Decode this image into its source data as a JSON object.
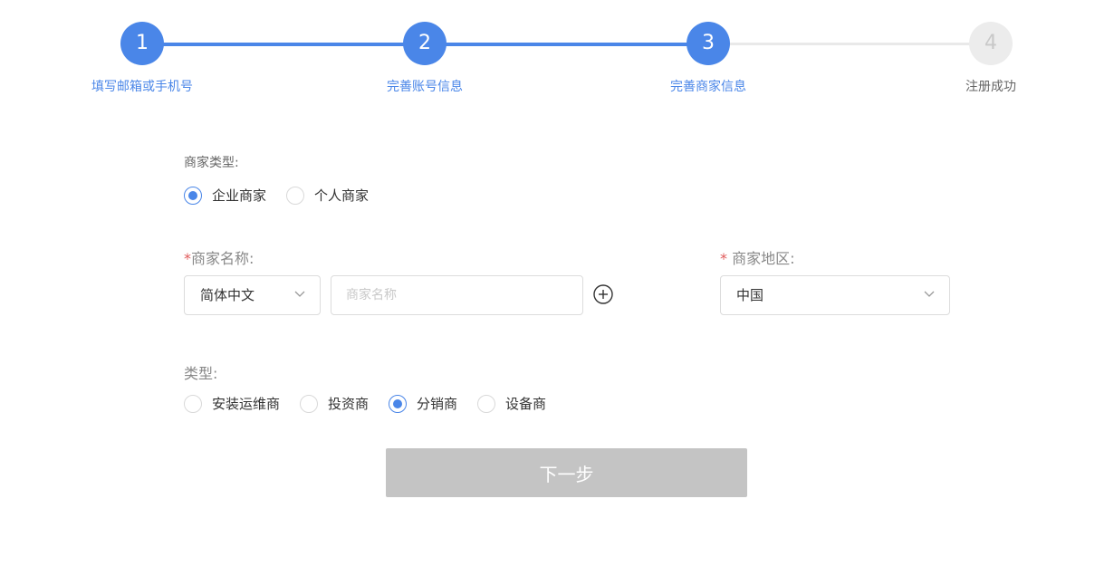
{
  "stepper": {
    "steps": [
      {
        "number": "1",
        "label": "填写邮箱或手机号",
        "status": "done"
      },
      {
        "number": "2",
        "label": "完善账号信息",
        "status": "done"
      },
      {
        "number": "3",
        "label": "完善商家信息",
        "status": "active"
      },
      {
        "number": "4",
        "label": "注册成功",
        "status": "pending"
      }
    ],
    "colors": {
      "active": "#4a86e8",
      "pending": "#ececec"
    }
  },
  "merchant_type": {
    "label": "商家类型:",
    "options": [
      {
        "label": "企业商家",
        "checked": true
      },
      {
        "label": "个人商家",
        "checked": false
      }
    ]
  },
  "merchant_name": {
    "required_mark": "*",
    "label": "商家名称:",
    "language_select": {
      "value": "简体中文",
      "icon": "chevron-down-icon"
    },
    "input": {
      "value": "",
      "placeholder": "商家名称"
    },
    "add_icon": "plus-circle-icon"
  },
  "merchant_region": {
    "required_mark": "*",
    "label": " 商家地区:",
    "select": {
      "value": "中国",
      "icon": "chevron-down-icon"
    }
  },
  "category": {
    "label": "类型:",
    "options": [
      {
        "label": "安装运维商",
        "checked": false
      },
      {
        "label": "投资商",
        "checked": false
      },
      {
        "label": "分销商",
        "checked": true
      },
      {
        "label": "设备商",
        "checked": false
      }
    ]
  },
  "actions": {
    "next_label": "下一步",
    "next_disabled_color": "#c4c4c4"
  }
}
